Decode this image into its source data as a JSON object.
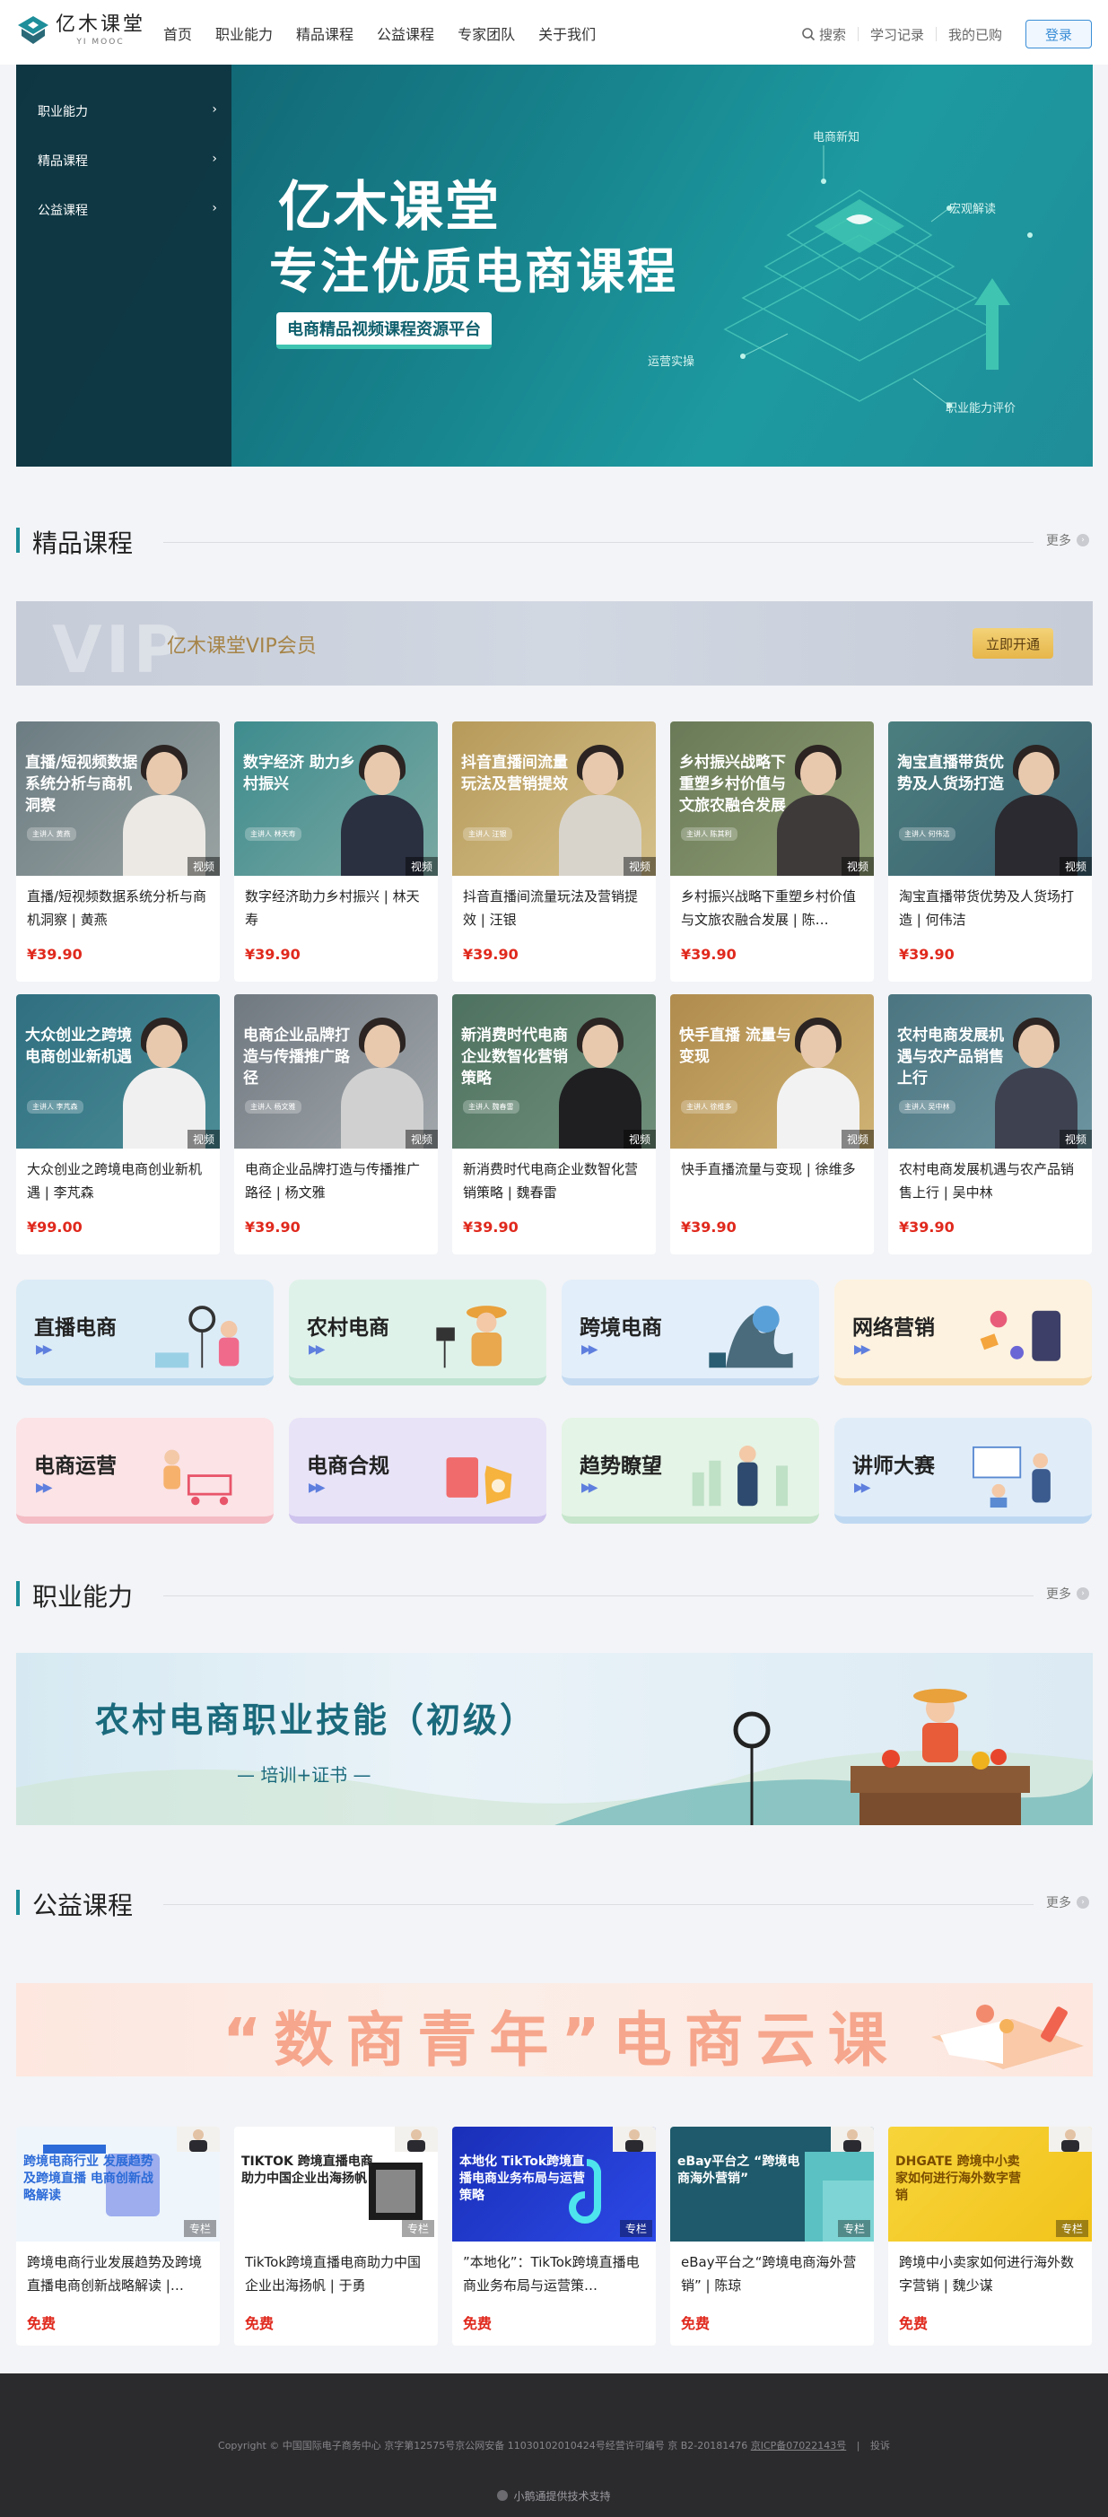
{
  "header": {
    "logo_cn": "亿木课堂",
    "logo_en": "YI MOOC",
    "nav": [
      "首页",
      "职业能力",
      "精品课程",
      "公益课程",
      "专家团队",
      "关于我们"
    ],
    "search_label": "搜索",
    "study_record": "学习记录",
    "purchased": "我的已购",
    "login": "登录"
  },
  "banner": {
    "side_items": [
      "职业能力",
      "精品课程",
      "公益课程"
    ],
    "title1": "亿木课堂",
    "title2": "专注优质电商课程",
    "subtitle": "电商精品视频课程资源平台",
    "tags": [
      "电商新知",
      "宏观解读",
      "运营实操",
      "职业能力评价"
    ]
  },
  "sections": {
    "premium": "精品课程",
    "career": "职业能力",
    "charity": "公益课程",
    "more": "更多"
  },
  "vip": {
    "ghost": "VIP",
    "text": "亿木课堂VIP会员",
    "button": "立即开通"
  },
  "courses": [
    {
      "thumb_title": "直播/短视频数据系统分析与商机洞察",
      "presenter": "主讲人 黄燕",
      "badge": "视频",
      "name": "直播/短视频数据系统分析与商机洞察 | 黄燕",
      "price": "¥39.90"
    },
    {
      "thumb_title": "数字经济 助力乡村振兴",
      "presenter": "主讲人 林天寿",
      "badge": "视频",
      "name": "数字经济助力乡村振兴 | 林天寿",
      "price": "¥39.90"
    },
    {
      "thumb_title": "抖音直播间流量玩法及营销提效",
      "presenter": "主讲人 汪银",
      "badge": "视频",
      "name": "抖音直播间流量玩法及营销提效 | 汪银",
      "price": "¥39.90"
    },
    {
      "thumb_title": "乡村振兴战略下重塑乡村价值与文旅农融合发展",
      "presenter": "主讲人 陈其利",
      "badge": "视频",
      "name": "乡村振兴战略下重塑乡村价值与文旅农融合发展 | 陈…",
      "price": "¥39.90"
    },
    {
      "thumb_title": "淘宝直播带货优势及人货场打造",
      "presenter": "主讲人 何伟洁",
      "badge": "视频",
      "name": "淘宝直播带货优势及人货场打造 | 何伟洁",
      "price": "¥39.90"
    },
    {
      "thumb_title": "大众创业之跨境电商创业新机遇",
      "presenter": "主讲人 李芃森",
      "badge": "视频",
      "name": "大众创业之跨境电商创业新机遇 | 李芃森",
      "price": "¥99.00"
    },
    {
      "thumb_title": "电商企业品牌打造与传播推广路径",
      "presenter": "主讲人 杨文雅",
      "badge": "视频",
      "name": "电商企业品牌打造与传播推广路径 | 杨文雅",
      "price": "¥39.90"
    },
    {
      "thumb_title": "新消费时代电商企业数智化营销策略",
      "presenter": "主讲人 魏春雷",
      "badge": "视频",
      "name": "新消费时代电商企业数智化营销策略 | 魏春雷",
      "price": "¥39.90"
    },
    {
      "thumb_title": "快手直播 流量与变现",
      "presenter": "主讲人 徐维多",
      "badge": "视频",
      "name": "快手直播流量与变现 | 徐维多",
      "price": "¥39.90"
    },
    {
      "thumb_title": "农村电商发展机遇与农产品销售上行",
      "presenter": "主讲人 吴中林",
      "badge": "视频",
      "name": "农村电商发展机遇与农产品销售上行 | 吴中林",
      "price": "¥39.90"
    }
  ],
  "categories": [
    "直播电商",
    "农村电商",
    "跨境电商",
    "网络营销",
    "电商运营",
    "电商合规",
    "趋势瞭望",
    "讲师大赛"
  ],
  "career_banner": {
    "title": "农村电商职业技能（初级）",
    "subtitle": "— 培训+证书 —"
  },
  "charity_banner": {
    "title": "“数商青年”电商云课"
  },
  "free_courses": [
    {
      "thumb_title": "跨境电商行业 发展趋势及跨境直播 电商创新战略解读",
      "badge": "专栏",
      "name": "跨境电商行业发展趋势及跨境直播电商创新战略解读 |…",
      "price": "免费"
    },
    {
      "thumb_title": "TIKTOK 跨境直播电商助力中国企业出海扬帆",
      "badge": "专栏",
      "name": "TikTok跨境直播电商助力中国企业出海扬帆 | 于勇",
      "price": "免费"
    },
    {
      "thumb_title": "本地化 TikTok跨境直播电商业务布局与运营策略",
      "badge": "专栏",
      "name": "”本地化”：TikTok跨境直播电商业务布局与运营策…",
      "price": "免费"
    },
    {
      "thumb_title": "eBay平台之 “跨境电商海外营销”",
      "badge": "专栏",
      "name": "eBay平台之“跨境电商海外营销” | 陈琼",
      "price": "免费"
    },
    {
      "thumb_title": "DHGATE 跨境中小卖家如何进行海外数字营销",
      "badge": "专栏",
      "name": "跨境中小卖家如何进行海外数字营销 | 魏少谋",
      "price": "免费"
    }
  ],
  "footer": {
    "copyright": "Copyright © 中国国际电子商务中心 京字第12575号京公网安备 11030102010424号经营许可编号 京 B2-20181476",
    "icp": "京ICP备07022143号",
    "report": "投诉",
    "tech": "小鹅通提供技术支持"
  }
}
